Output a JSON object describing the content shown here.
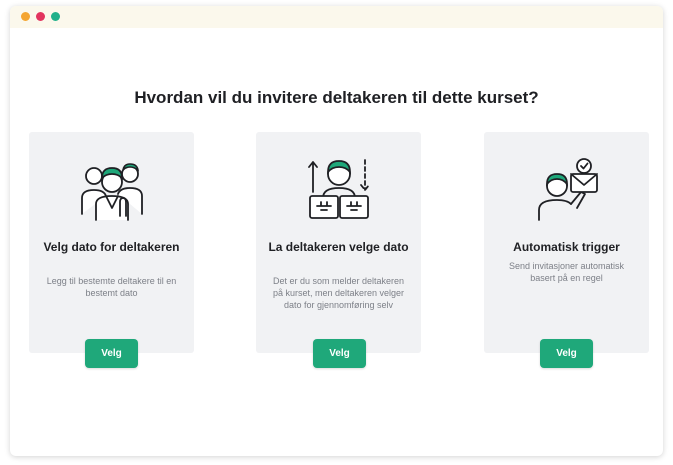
{
  "heading": "Hvordan vil du invitere deltakeren til dette kurset?",
  "cards": [
    {
      "icon": "group-people-icon",
      "title": "Velg dato for deltakeren",
      "description": "Legg til bestemte deltakere til en bestemt dato",
      "button": "Velg"
    },
    {
      "icon": "person-choosing-date-icon",
      "title": "La deltakeren velge dato",
      "description": "Det er du som melder deltakeren på kurset, men deltakeren velger dato for gjennomføring selv",
      "button": "Velg"
    },
    {
      "icon": "person-with-mail-icon",
      "title": "Automatisk trigger",
      "description": "Send invitasjoner automatisk basert på en regel",
      "button": "Velg"
    }
  ],
  "colors": {
    "accent": "#1fa87a",
    "card_bg": "#f1f2f4",
    "dot_orange": "#f4a531",
    "dot_red": "#e2345f",
    "dot_green": "#21b08a"
  }
}
